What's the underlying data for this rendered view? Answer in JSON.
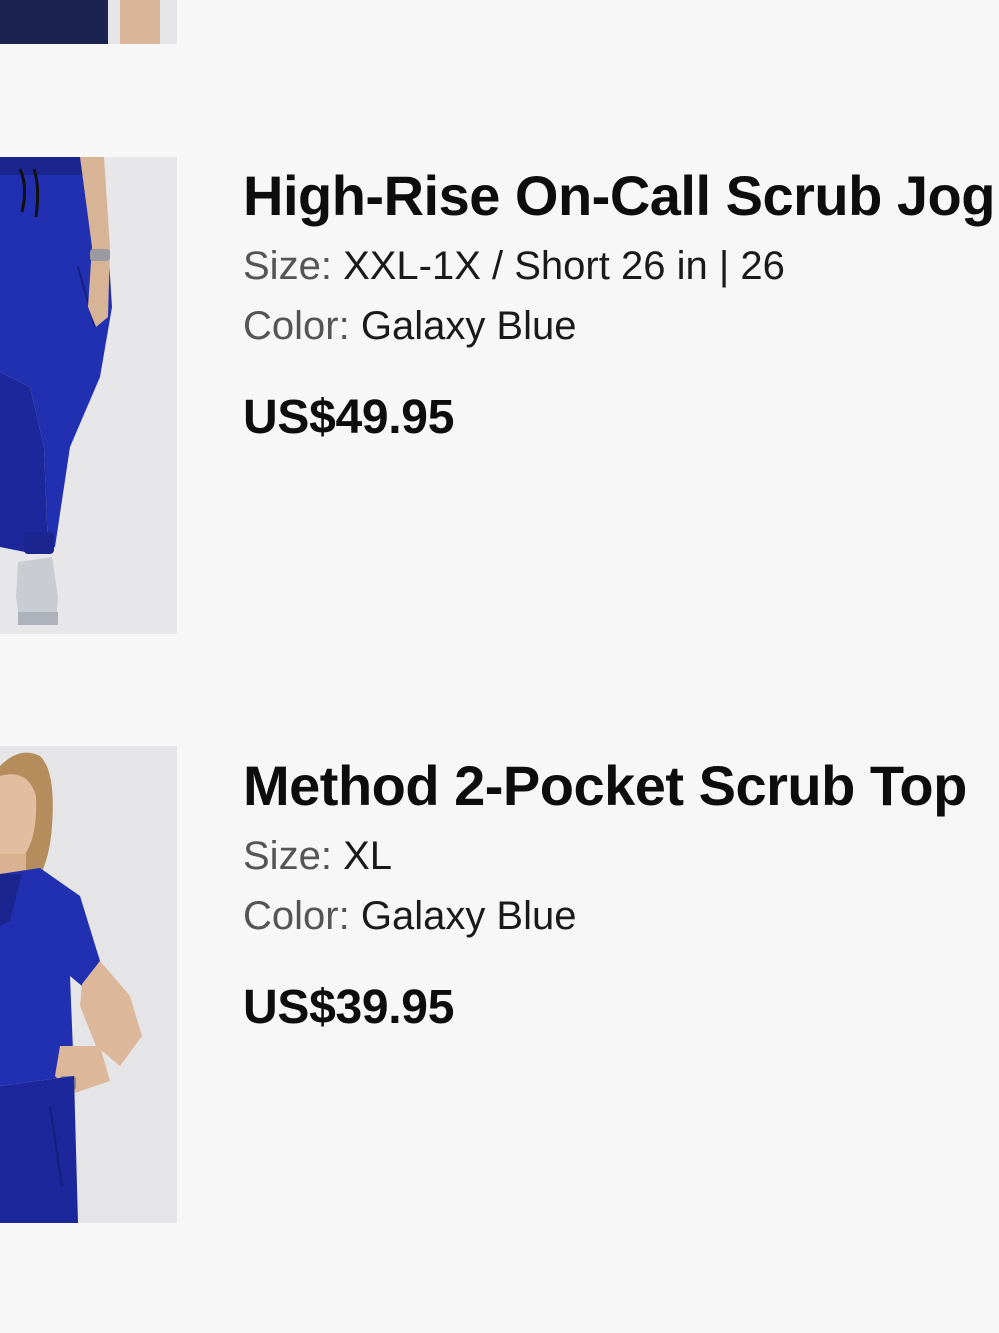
{
  "colors": {
    "background": "#f7f7f7",
    "galaxy_blue": "#1f2aa8",
    "text": "#111111",
    "label": "#555555"
  },
  "items": [
    {
      "title": "High-Rise On-Call Scrub Jog",
      "size_label": "Size:",
      "size_value": "XXL-1X / Short 26 in | 26",
      "color_label": "Color:",
      "color_value": "Galaxy Blue",
      "price": "US$49.95",
      "image": "scrub-jogger-pants-photo"
    },
    {
      "title": "Method 2-Pocket Scrub Top",
      "size_label": "Size:",
      "size_value": "XL",
      "color_label": "Color:",
      "color_value": "Galaxy Blue",
      "price": "US$39.95",
      "image": "scrub-top-photo"
    }
  ]
}
